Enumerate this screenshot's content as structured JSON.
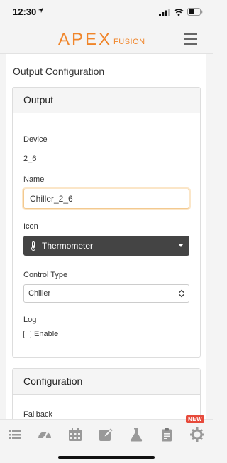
{
  "status_bar": {
    "time": "12:30"
  },
  "header": {
    "logo_main": "APEX",
    "logo_sub": "FUSION"
  },
  "page": {
    "title": "Output Configuration"
  },
  "output_panel": {
    "heading": "Output",
    "device_label": "Device",
    "device_value": "2_6",
    "name_label": "Name",
    "name_value": "Chiller_2_6",
    "icon_label": "Icon",
    "icon_value": "Thermometer",
    "control_type_label": "Control Type",
    "control_type_value": "Chiller",
    "log_label": "Log",
    "log_checkbox_label": "Enable",
    "log_enabled": false
  },
  "config_panel": {
    "heading": "Configuration",
    "fallback_label": "Fallback"
  },
  "tabbar": {
    "tabs": [
      {
        "icon": "list-icon"
      },
      {
        "icon": "dashboard-gauge-icon"
      },
      {
        "icon": "calendar-icon"
      },
      {
        "icon": "edit-icon"
      },
      {
        "icon": "flask-icon"
      },
      {
        "icon": "clipboard-icon"
      },
      {
        "icon": "gear-icon"
      }
    ],
    "new_badge": "NEW"
  },
  "colors": {
    "brand_orange": "#f0852a",
    "badge_red": "#e74a3b",
    "select_dark": "#444444"
  }
}
